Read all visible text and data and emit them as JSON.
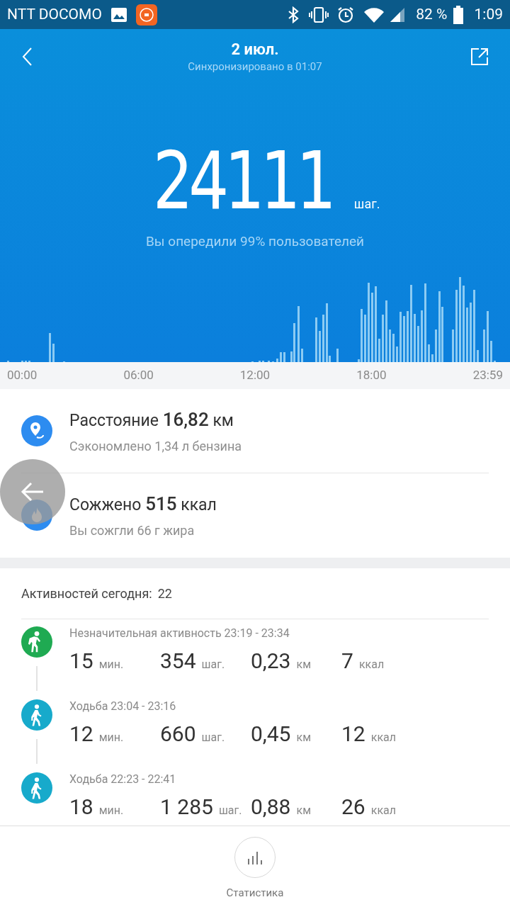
{
  "status_bar": {
    "carrier": "NTT DOCOMO",
    "battery": "82 %",
    "time": "1:09"
  },
  "header": {
    "title": "2 июл.",
    "subtitle": "Синхронизировано в 01:07"
  },
  "summary": {
    "steps": "24111",
    "unit": "шаг.",
    "rank": "Вы опередили 99% пользователей"
  },
  "chart_axis": [
    "00:00",
    "06:00",
    "12:00",
    "18:00",
    "23:59"
  ],
  "metrics": [
    {
      "kind": "distance",
      "headline": "Расстояние **16,82** км",
      "detail": "Сэкономлено 1,34 л бензина"
    },
    {
      "kind": "calories",
      "headline": "Сожжено **515** ккал",
      "detail": "Вы сожгли 66 г жира"
    }
  ],
  "activities_header": {
    "label": "Активностей сегодня:",
    "count": "22"
  },
  "activities": [
    {
      "kind": "light",
      "color": "#1faa52",
      "title": "Незначительная активность 23:19 - 23:34",
      "stats": [
        {
          "value": "15",
          "unit": "мин."
        },
        {
          "value": "354",
          "unit": "шаг."
        },
        {
          "value": "0,23",
          "unit": "км"
        },
        {
          "value": "7",
          "unit": "ккал"
        }
      ]
    },
    {
      "kind": "walk",
      "color": "#17aacb",
      "title": "Ходьба 23:04 - 23:16",
      "stats": [
        {
          "value": "12",
          "unit": "мин."
        },
        {
          "value": "660",
          "unit": "шаг."
        },
        {
          "value": "0,45",
          "unit": "км"
        },
        {
          "value": "12",
          "unit": "ккал"
        }
      ]
    },
    {
      "kind": "walk",
      "color": "#17aacb",
      "title": "Ходьба 22:23 - 22:41",
      "stats": [
        {
          "value": "18",
          "unit": "мин."
        },
        {
          "value": "1 285",
          "unit": "шаг."
        },
        {
          "value": "0,88",
          "unit": "км"
        },
        {
          "value": "26",
          "unit": "ккал"
        }
      ]
    }
  ],
  "bottom_nav": {
    "label": "Статистика"
  }
}
